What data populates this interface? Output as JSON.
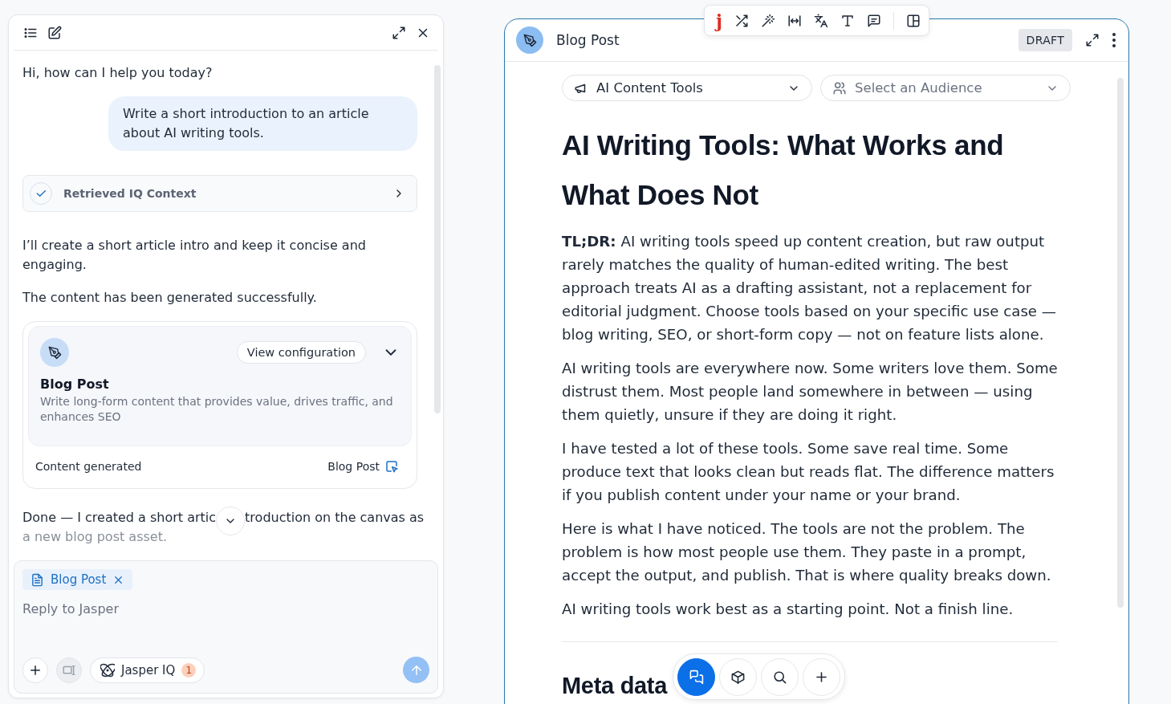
{
  "chat_panel": {
    "messages": [
      {
        "kind": "assistant",
        "text": "Hi, how can I help you today?"
      },
      {
        "kind": "user",
        "text": "Write a short introduction to an article about AI writing tools."
      },
      {
        "kind": "context",
        "label": "Retrieved IQ Context",
        "done": true
      },
      {
        "kind": "assistant",
        "text": "I’ll create a short article intro and keep it concise and engaging."
      },
      {
        "kind": "assistant",
        "text": "The content has been generated successfully."
      },
      {
        "kind": "asset",
        "title": "Blog Post",
        "description": "Write long-form content that provides value, drives traffic, and enhances SEO",
        "config_button": "View configuration",
        "status": "Content generated",
        "link": "Blog Post"
      },
      {
        "kind": "covered",
        "parts": [
          "Done — I created a short artic",
          "troduction on the canvas as",
          "a new blog post asset."
        ]
      }
    ],
    "composer": {
      "attachment": "Blog Post",
      "placeholder": "Reply to Jasper",
      "iq_button": "Jasper IQ",
      "iq_count": "1"
    }
  },
  "editor": {
    "title": "Blog Post",
    "status": "DRAFT",
    "format_toolbar": {
      "logo": "j"
    },
    "selectors": [
      {
        "label": "AI Content Tools",
        "placeholder": false
      },
      {
        "label": "Select an Audience",
        "placeholder": true
      }
    ],
    "heading": "AI Writing Tools: What Works and What Does Not",
    "paragraphs": [
      "**TL;DR:** AI writing tools speed up content creation, but raw output rarely matches the quality of human-edited writing. The best approach treats AI as a drafting assistant, not a replacement for editorial judgment. Choose tools based on your specific use case — blog writing, SEO, or short-form copy — not on feature lists alone.",
      "AI writing tools are everywhere now. Some writers love them. Some distrust them. Most people land somewhere in between — using them quietly, unsure if they are doing it right.",
      "I have tested a lot of these tools. Some save real time. Some produce text that looks clean but reads flat. The difference matters if you publish content under your name or your brand.",
      "Here is what I have noticed. The tools are not the problem. The problem is how most people use them. They paste in a prompt, accept the output, and publish. That is where quality breaks down.",
      "AI writing tools work best as a starting point. Not a finish line."
    ],
    "section_heading": "Meta data",
    "dock": [
      {
        "kind": "chat",
        "selected": true
      },
      {
        "kind": "cube",
        "selected": false
      },
      {
        "kind": "search",
        "selected": false
      },
      {
        "kind": "add",
        "selected": false
      }
    ]
  }
}
